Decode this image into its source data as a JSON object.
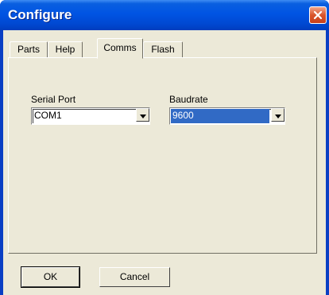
{
  "window": {
    "title": "Configure",
    "close_icon": "close-icon"
  },
  "tabs": [
    {
      "label": "Parts",
      "active": false
    },
    {
      "label": "Help",
      "active": false
    },
    {
      "label": "Comms",
      "active": true
    },
    {
      "label": "Flash",
      "active": false
    }
  ],
  "comms": {
    "serial_port_label": "Serial Port",
    "serial_port_value": "COM1",
    "baudrate_label": "Baudrate",
    "baudrate_value": "9600"
  },
  "buttons": {
    "ok_label": "OK",
    "cancel_label": "Cancel"
  },
  "colors": {
    "titlebar": "#0054e3",
    "selection": "#316ac5",
    "face": "#ece9d8",
    "close": "#d9552c"
  }
}
